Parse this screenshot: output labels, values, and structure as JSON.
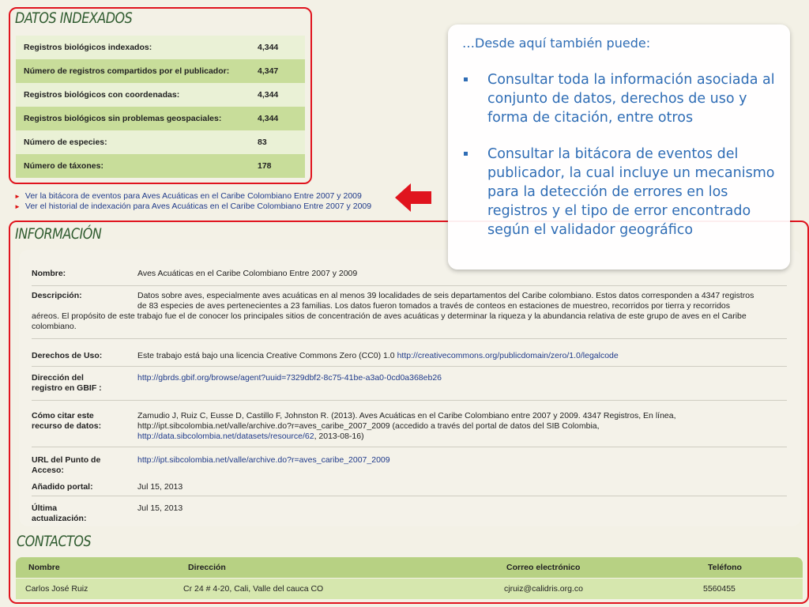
{
  "datos": {
    "title": "DATOS INDEXADOS",
    "rows": [
      {
        "label": "Registros biológicos indexados:",
        "value": "4,344"
      },
      {
        "label": "Número de registros compartidos por el publicador:",
        "value": "4,347"
      },
      {
        "label": "Registros biológicos con coordenadas:",
        "value": "4,344"
      },
      {
        "label": "Registros biológicos sin problemas geospaciales:",
        "value": "4,344"
      },
      {
        "label": "Número de especies:",
        "value": "83"
      },
      {
        "label": "Número de táxones:",
        "value": "178"
      }
    ]
  },
  "links": [
    "Ver la bitácora de eventos para Aves Acuáticas en el Caribe Colombiano Entre 2007 y 2009",
    "Ver el historial de indexación para Aves Acuáticas en el Caribe Colombiano Entre 2007 y 2009"
  ],
  "info": {
    "title": "INFORMACIÓN",
    "nombre_label": "Nombre:",
    "nombre": "Aves Acuáticas en el Caribe Colombiano Entre 2007 y 2009",
    "descripcion_label": "Descripción:",
    "descripcion_1": "Datos sobre aves, especialmente aves acuáticas en al menos 39 localidades de seis departamentos del Caribe colombiano. Estos datos corresponden a 4347 registros",
    "descripcion_2": "de 83 especies de aves pertenecientes a 23 familias. Los datos fueron tomados a través de conteos en estaciones de muestreo, recorridos por tierra y recorridos",
    "descripcion_3": "aéreos. El propósito de este trabajo fue el de conocer los principales sitios de concentración de aves acuáticas y determinar la riqueza y la abundancia relativa de este grupo de aves en el Caribe",
    "descripcion_4": "colombiano.",
    "derechos_label": "Derechos de Uso:",
    "derechos_text": "Este trabajo está bajo una licencia Creative Commons Zero (CC0) 1.0 ",
    "derechos_link": "http://creativecommons.org/publicdomain/zero/1.0/legalcode",
    "direccion_label_1": "Dirección del",
    "direccion_label_2": "registro en GBIF :",
    "direccion_link": "http://gbrds.gbif.org/browse/agent?uuid=7329dbf2-8c75-41be-a3a0-0cd0a368eb26",
    "citar_label_1": "Cómo citar este",
    "citar_label_2": "recurso de datos:",
    "citar_1": "Zamudio J, Ruiz C, Eusse D, Castillo F, Johnston R. (2013). Aves Acuáticas en el Caribe Colombiano entre 2007 y 2009. 4347 Registros, En línea,",
    "citar_2": "http://ipt.sibcolombia.net/valle/archive.do?r=aves_caribe_2007_2009 (accedido a través del portal de datos del SIB Colombia,",
    "citar_link": "http://data.sibcolombia.net/datasets/resource/62",
    "citar_3": ", 2013-08-16)",
    "url_label_1": "URL del Punto de",
    "url_label_2": "Acceso:",
    "url_link": "http://ipt.sibcolombia.net/valle/archive.do?r=aves_caribe_2007_2009",
    "anadido_label": "Añadido portal:",
    "anadido": "Jul 15, 2013",
    "ultima_label_1": "Última",
    "ultima_label_2": "actualización:",
    "ultima": "Jul 15, 2013"
  },
  "contactos": {
    "title": "CONTACTOS",
    "headers": [
      "Nombre",
      "Dirección",
      "Correo electrónico",
      "Teléfono"
    ],
    "row": [
      "Carlos José Ruiz",
      "Cr 24 # 4-20, Cali, Valle del cauca CO",
      "cjruiz@calidris.org.co",
      "5560455"
    ]
  },
  "callout": {
    "intro": "…Desde aquí también puede:",
    "items": [
      "Consultar toda la información asociada al conjunto de datos, derechos de uso y forma de citación, entre otros",
      "Consultar la bitácora de eventos del publicador, la cual incluye un mecanismo para la detección de errores en los registros y el tipo de error encontrado según el validador geográfico"
    ]
  },
  "colors": {
    "highlight_border": "#e0141e",
    "table_dark": "#c8dd9a",
    "table_light": "#eaf1d6",
    "callout_text": "#2f6db5"
  }
}
